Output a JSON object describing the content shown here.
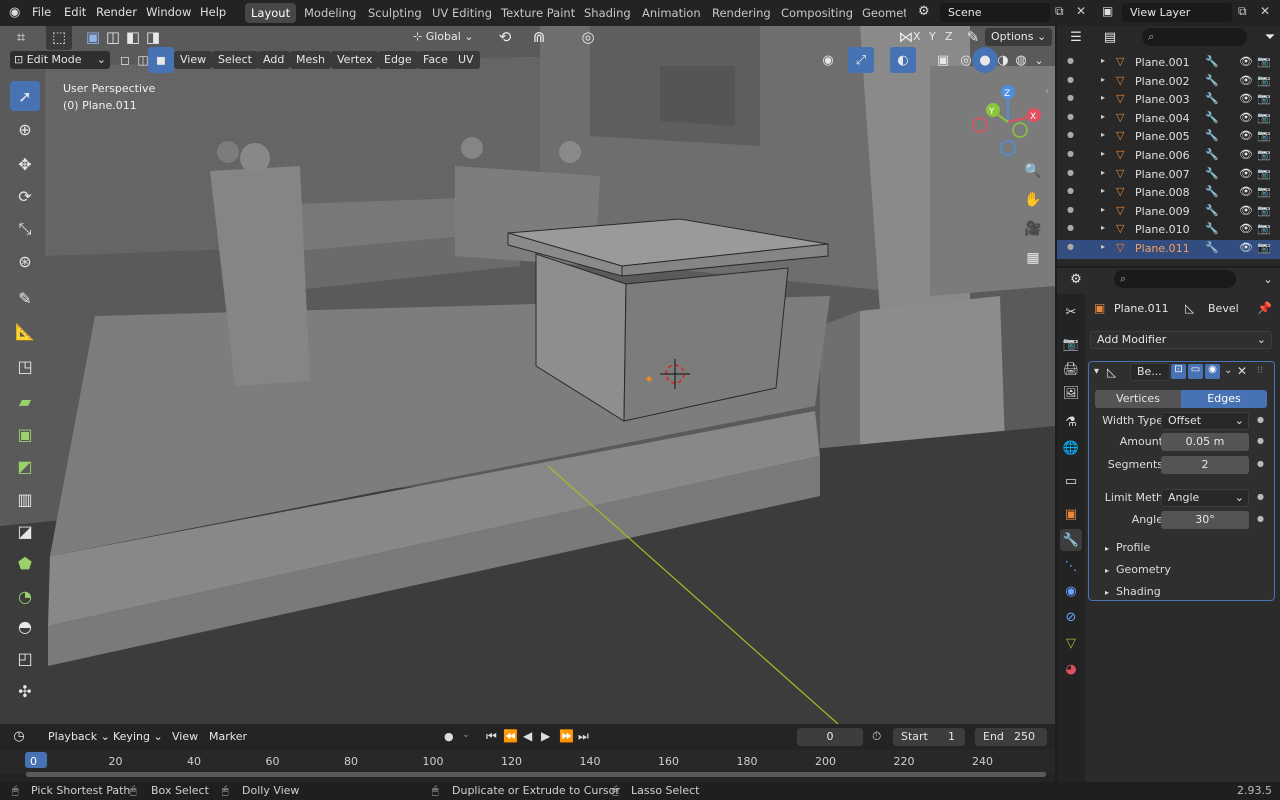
{
  "menus": [
    "File",
    "Edit",
    "Render",
    "Window",
    "Help"
  ],
  "workspaces": [
    "Layout",
    "Modeling",
    "Sculpting",
    "UV Editing",
    "Texture Paint",
    "Shading",
    "Animation",
    "Rendering",
    "Compositing",
    "Geometr"
  ],
  "scene": "Scene",
  "view_layer": "View Layer",
  "viewport": {
    "mode": "Edit Mode",
    "header_menus": [
      "View",
      "Select",
      "Add",
      "Mesh",
      "Vertex",
      "Edge",
      "Face",
      "UV"
    ],
    "transform": "Global",
    "options": "Options",
    "perspective": "User Perspective",
    "object_label": "(0) Plane.011",
    "gizmo": {
      "x": "X",
      "y": "Y",
      "z": "Z"
    },
    "axis_toggles": [
      "X",
      "Y",
      "Z"
    ]
  },
  "outliner": {
    "items": [
      "Plane.001",
      "Plane.002",
      "Plane.003",
      "Plane.004",
      "Plane.005",
      "Plane.006",
      "Plane.007",
      "Plane.008",
      "Plane.009",
      "Plane.010",
      "Plane.011"
    ],
    "selected": "Plane.011"
  },
  "properties": {
    "object": "Plane.011",
    "modifier_name_crumb": "Bevel",
    "add_modifier": "Add Modifier",
    "modifier_short": "Be...",
    "affect_tabs": [
      "Vertices",
      "Edges"
    ],
    "affect_active": "Edges",
    "width_type_label": "Width Type",
    "width_type": "Offset",
    "amount_label": "Amount",
    "amount": "0.05 m",
    "segments_label": "Segments",
    "segments": "2",
    "limit_label": "Limit Meth",
    "limit": "Angle",
    "angle_label": "Angle",
    "angle": "30°",
    "panels": [
      "Profile",
      "Geometry",
      "Shading"
    ]
  },
  "timeline": {
    "menus": [
      "Playback",
      "Keying",
      "View",
      "Marker"
    ],
    "current": "0",
    "start_label": "Start",
    "start": "1",
    "end_label": "End",
    "end": "250",
    "ticks": [
      "0",
      "20",
      "40",
      "60",
      "80",
      "100",
      "120",
      "140",
      "160",
      "180",
      "200",
      "220",
      "240"
    ]
  },
  "status": {
    "items": [
      "Pick Shortest Path",
      "Box Select",
      "Dolly View",
      "Duplicate or Extrude to Cursor",
      "Lasso Select"
    ],
    "version": "2.93.5"
  },
  "colors": {
    "accent": "#4772b3",
    "selected_row": "#334d80",
    "object_orange": "#e8883a",
    "axis_x": "#e05060",
    "axis_y": "#8cc43c",
    "axis_z": "#4f8fe0"
  }
}
